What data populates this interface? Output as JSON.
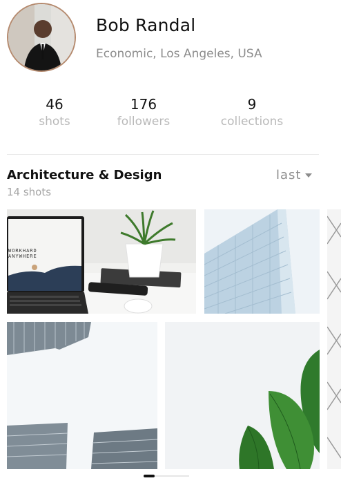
{
  "profile": {
    "name": "Bob Randal",
    "location": "Economic, Los Angeles, USA",
    "avatar_icon": "avatar-photo"
  },
  "stats": [
    {
      "value": "46",
      "label": "shots"
    },
    {
      "value": "176",
      "label": "followers"
    },
    {
      "value": "9",
      "label": "collections"
    }
  ],
  "section": {
    "title": "Architecture & Design",
    "count": "14 shots",
    "sort_label": "last",
    "sort_icon": "caret-down-icon"
  },
  "shots": [
    {
      "subject": "laptop-plant-desk",
      "laptop_text_1": "WORKHARD",
      "laptop_text_2": "ANYWHERE"
    },
    {
      "subject": "glass-building"
    },
    {
      "subject": "glass-building-partial"
    },
    {
      "subject": "skyscrapers-upward"
    },
    {
      "subject": "green-leaf"
    }
  ],
  "colors": {
    "avatar_border": "#b58a6e",
    "muted_text": "#8c8c8c",
    "light_text": "#b9b9b9"
  }
}
